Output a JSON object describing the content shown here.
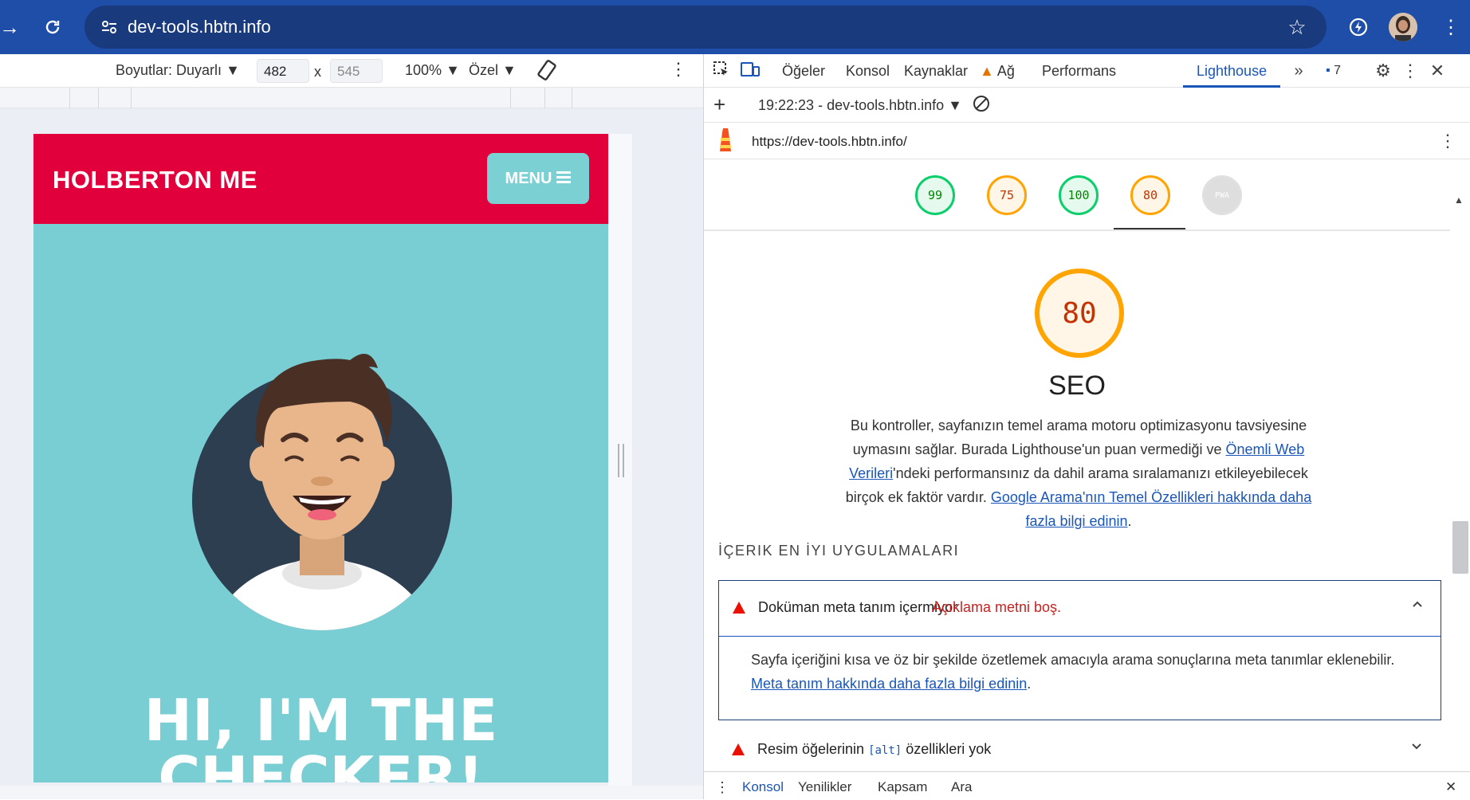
{
  "browser": {
    "url": "dev-tools.hbtn.info"
  },
  "device_toolbar": {
    "dimensions_label": "Boyutlar: Duyarlı",
    "width": "482",
    "x_sep": "x",
    "height": "545",
    "zoom": "100%",
    "throttle": "Özel"
  },
  "device_page": {
    "brand": "HOLBERTON ME",
    "menu_label": "MENU",
    "hero_line1": "HI, I'M THE",
    "hero_line2": "CHECKER!"
  },
  "devtools": {
    "tabs": [
      "Öğeler",
      "Konsol",
      "Kaynaklar",
      "Ağ",
      "Performans",
      "Lighthouse"
    ],
    "active_tab": "Lighthouse",
    "issues_count": "7",
    "report_selector": "19:22:23 - dev-tools.hbtn.info",
    "report_url": "https://dev-tools.hbtn.info/"
  },
  "lighthouse": {
    "scores": [
      {
        "value": "99",
        "status": "pass"
      },
      {
        "value": "75",
        "status": "average"
      },
      {
        "value": "100",
        "status": "pass"
      },
      {
        "value": "80",
        "status": "average"
      },
      {
        "value": "PWA",
        "status": "na"
      }
    ],
    "selected_score": "80",
    "category_title": "SEO",
    "description_part1": "Bu kontroller, sayfanızın temel arama motoru optimizasyonu tavsiyesine uymasını sağlar. Burada Lighthouse'un puan vermediği ve ",
    "description_link1": "Önemli Web Verileri",
    "description_part2": "'ndeki performansınız da dahil arama sıralamanızı etkileyebilecek birçok ek faktör vardır. ",
    "description_link2": "Google Arama'nın Temel Özellikleri hakkında daha fazla bilgi edinin",
    "description_end": ".",
    "group_title": "İÇERIK EN İYI UYGULAMALARI",
    "audits": [
      {
        "title": "Doküman meta tanım içermiyor",
        "display_value": "Açıklama metni boş.",
        "description": "Sayfa içeriğini kısa ve öz bir şekilde özetlemek amacıyla arama sonuçlarına meta tanımlar eklenebilir. ",
        "link": "Meta tanım hakkında daha fazla bilgi edinin",
        "link_end": "."
      },
      {
        "title_before": "Resim öğelerinin ",
        "title_code": "[alt]",
        "title_after": " özellikleri yok"
      }
    ],
    "colors": {
      "pass": "#0cce6b",
      "average": "#ffa400",
      "fail": "#ff4e42"
    }
  },
  "drawer": {
    "tabs": [
      "Konsol",
      "Yenilikler",
      "Kapsam",
      "Ara"
    ]
  }
}
